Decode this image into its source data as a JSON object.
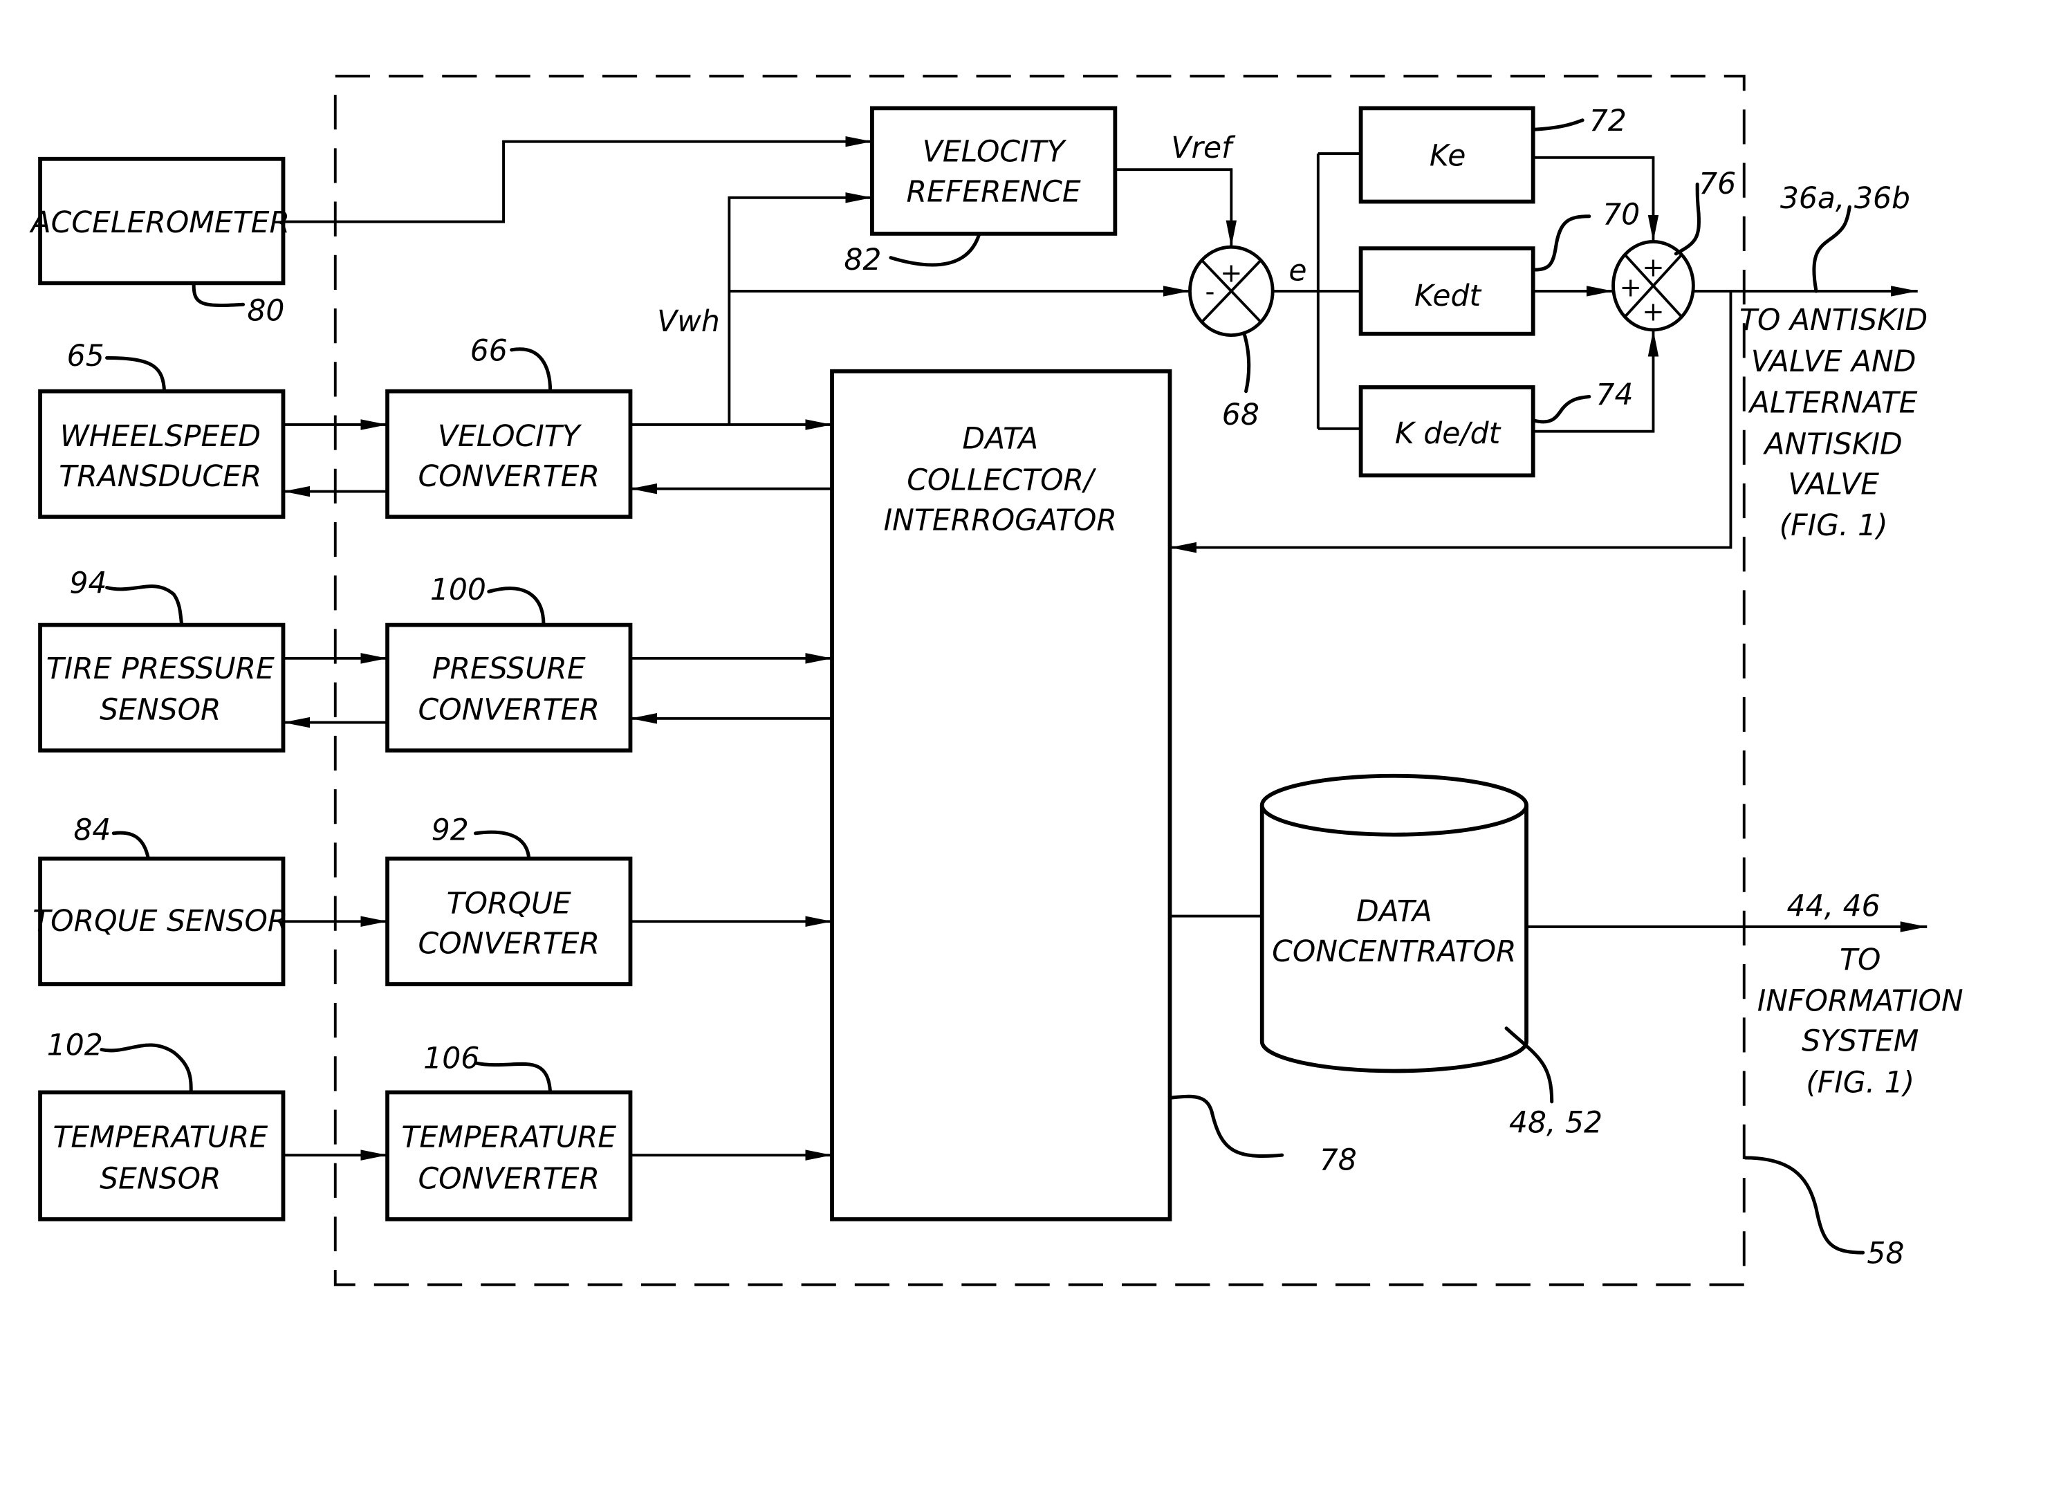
{
  "diagram": {
    "blocks": {
      "accelerometer": {
        "label": [
          "ACCELEROMETER"
        ],
        "ref": "80"
      },
      "wheelspeed_transducer": {
        "label": [
          "WHEELSPEED",
          "TRANSDUCER"
        ],
        "ref": "65"
      },
      "tire_pressure_sensor": {
        "label": [
          "TIRE PRESSURE",
          "SENSOR"
        ],
        "ref": "94"
      },
      "torque_sensor": {
        "label": [
          "TORQUE SENSOR"
        ],
        "ref": "84"
      },
      "temperature_sensor": {
        "label": [
          "TEMPERATURE",
          "SENSOR"
        ],
        "ref": "102"
      },
      "velocity_converter": {
        "label": [
          "VELOCITY",
          "CONVERTER"
        ],
        "ref": "66"
      },
      "pressure_converter": {
        "label": [
          "PRESSURE",
          "CONVERTER"
        ],
        "ref": "100"
      },
      "torque_converter": {
        "label": [
          "TORQUE",
          "CONVERTER"
        ],
        "ref": "92"
      },
      "temperature_converter": {
        "label": [
          "TEMPERATURE",
          "CONVERTER"
        ],
        "ref": "106"
      },
      "velocity_reference": {
        "label": [
          "VELOCITY",
          "REFERENCE"
        ],
        "ref": "82"
      },
      "data_collector": {
        "label": [
          "DATA",
          "COLLECTOR/",
          "INTERROGATOR"
        ],
        "ref": "78"
      },
      "data_concentrator": {
        "label": [
          "DATA",
          "CONCENTRATOR"
        ],
        "ref": "48, 52"
      },
      "ke": {
        "label": [
          "Ke"
        ],
        "ref": "72"
      },
      "kedt": {
        "label": [
          "Kedt"
        ],
        "ref": "70"
      },
      "kdedt": {
        "label": [
          "K de/dt"
        ],
        "ref": "74"
      }
    },
    "summers": {
      "error_summer": {
        "ref": "68",
        "signs": {
          "top": "+",
          "left": "-"
        }
      },
      "output_summer": {
        "ref": "76",
        "signs": {
          "top": "+",
          "left": "+",
          "bottom": "+"
        }
      }
    },
    "signals": {
      "vref": "Vref",
      "vwh": "Vwh",
      "e": "e"
    },
    "outputs": {
      "antiskid": {
        "ref": "36a, 36b",
        "label": [
          "TO ANTISKID",
          "VALVE AND",
          "ALTERNATE",
          "ANTISKID",
          "VALVE",
          "(FIG. 1)"
        ]
      },
      "information": {
        "ref": "44, 46",
        "label": [
          "TO",
          "INFORMATION",
          "SYSTEM",
          "(FIG. 1)"
        ]
      }
    },
    "enclosure": {
      "ref": "58"
    }
  }
}
